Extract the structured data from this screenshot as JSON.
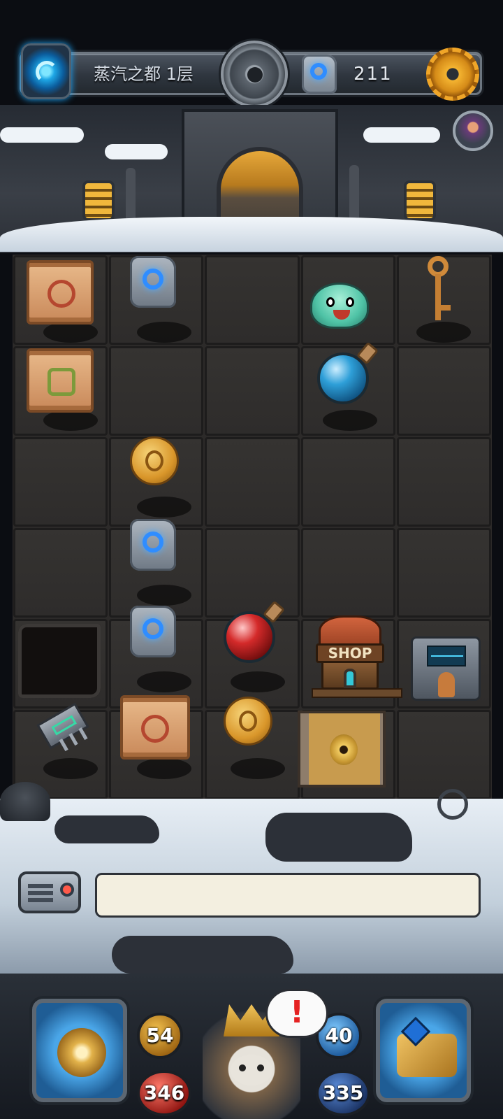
{
  "header": {
    "floor_title": "蒸汽之都 1层",
    "rune_count": "211",
    "icons": [
      "portal-icon",
      "bomb-icon",
      "rune-stone-icon",
      "gear-icon",
      "avatar-icon"
    ]
  },
  "board": {
    "rows": 6,
    "cols": 5,
    "items": [
      {
        "row": 1,
        "col": 1,
        "type": "red-scroll"
      },
      {
        "row": 1,
        "col": 2,
        "type": "blue-rune-stone"
      },
      {
        "row": 1,
        "col": 4,
        "type": "green-slime-monster"
      },
      {
        "row": 1,
        "col": 5,
        "type": "bronze-key"
      },
      {
        "row": 2,
        "col": 1,
        "type": "green-scroll"
      },
      {
        "row": 2,
        "col": 4,
        "type": "blue-potion"
      },
      {
        "row": 3,
        "col": 2,
        "type": "gold-coin"
      },
      {
        "row": 4,
        "col": 2,
        "type": "blue-rune-stone"
      },
      {
        "row": 5,
        "col": 1,
        "type": "floor-hole"
      },
      {
        "row": 5,
        "col": 2,
        "type": "blue-rune-stone"
      },
      {
        "row": 5,
        "col": 3,
        "type": "red-potion"
      },
      {
        "row": 5,
        "col": 4,
        "type": "shop"
      },
      {
        "row": 5,
        "col": 5,
        "type": "machine"
      },
      {
        "row": 6,
        "col": 1,
        "type": "chip"
      },
      {
        "row": 6,
        "col": 2,
        "type": "bird-scroll"
      },
      {
        "row": 6,
        "col": 3,
        "type": "gold-coin"
      },
      {
        "row": 6,
        "col": 4,
        "type": "locked-wooden-door"
      }
    ]
  },
  "shop_label": "SHOP",
  "message": "",
  "stats": {
    "attack": "54",
    "defense": "40",
    "hp": "346",
    "mp": "335"
  },
  "alert": "!",
  "colors": {
    "accent_gold": "#f4b431",
    "rune_blue": "#2f8dff",
    "alert_red": "#e52222"
  }
}
